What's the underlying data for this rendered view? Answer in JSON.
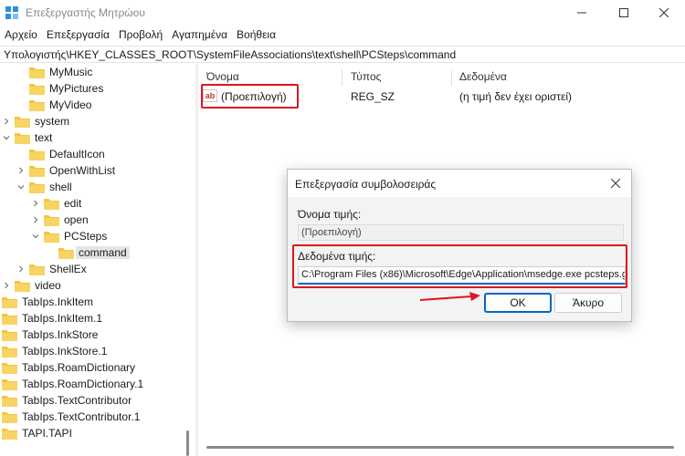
{
  "window": {
    "title": "Επεξεργαστής Μητρώου"
  },
  "menu": [
    "Αρχείο",
    "Επεξεργασία",
    "Προβολή",
    "Αγαπημένα",
    "Βοήθεια"
  ],
  "address": "Υπολογιστής\\HKEY_CLASSES_ROOT\\SystemFileAssociations\\text\\shell\\PCSteps\\command",
  "tree": [
    {
      "label": "MyMusic",
      "depth": 1,
      "expander": "none"
    },
    {
      "label": "MyPictures",
      "depth": 1,
      "expander": "none"
    },
    {
      "label": "MyVideo",
      "depth": 1,
      "expander": "none"
    },
    {
      "label": "system",
      "depth": 0,
      "expander": "collapsed"
    },
    {
      "label": "text",
      "depth": 0,
      "expander": "expanded"
    },
    {
      "label": "DefaultIcon",
      "depth": 1,
      "expander": "none"
    },
    {
      "label": "OpenWithList",
      "depth": 1,
      "expander": "collapsed"
    },
    {
      "label": "shell",
      "depth": 1,
      "expander": "expanded"
    },
    {
      "label": "edit",
      "depth": 2,
      "expander": "collapsed"
    },
    {
      "label": "open",
      "depth": 2,
      "expander": "collapsed"
    },
    {
      "label": "PCSteps",
      "depth": 2,
      "expander": "expanded"
    },
    {
      "label": "command",
      "depth": 3,
      "expander": "none",
      "selected": true
    },
    {
      "label": "ShellEx",
      "depth": 1,
      "expander": "collapsed"
    },
    {
      "label": "video",
      "depth": 0,
      "expander": "collapsed"
    },
    {
      "label": "TabIps.InkItem",
      "depth": -1,
      "expander": "none"
    },
    {
      "label": "TabIps.InkItem.1",
      "depth": -1,
      "expander": "none"
    },
    {
      "label": "TabIps.InkStore",
      "depth": -1,
      "expander": "none"
    },
    {
      "label": "TabIps.InkStore.1",
      "depth": -1,
      "expander": "none"
    },
    {
      "label": "TabIps.RoamDictionary",
      "depth": -1,
      "expander": "none"
    },
    {
      "label": "TabIps.RoamDictionary.1",
      "depth": -1,
      "expander": "none"
    },
    {
      "label": "TabIps.TextContributor",
      "depth": -1,
      "expander": "none"
    },
    {
      "label": "TabIps.TextContributor.1",
      "depth": -1,
      "expander": "none"
    },
    {
      "label": "TAPI.TAPI",
      "depth": -1,
      "expander": "none"
    }
  ],
  "list": {
    "columns": [
      "Όνομα",
      "Τύπος",
      "Δεδομένα"
    ],
    "rows": [
      {
        "icon": "ab",
        "name": "(Προεπιλογή)",
        "type": "REG_SZ",
        "data": "(η τιμή δεν έχει οριστεί)"
      }
    ]
  },
  "dialog": {
    "title": "Επεξεργασία συμβολοσειράς",
    "name_label": "Όνομα τιμής:",
    "name_value": "(Προεπιλογή)",
    "data_label": "Δεδομένα τιμής:",
    "data_value": "C:\\Program Files (x86)\\Microsoft\\Edge\\Application\\msedge.exe pcsteps.g",
    "ok_label": "OK",
    "cancel_label": "Άκυρο"
  },
  "colors": {
    "highlight": "#e0141e",
    "accent": "#0067c0",
    "folder": "#f3c53f"
  }
}
